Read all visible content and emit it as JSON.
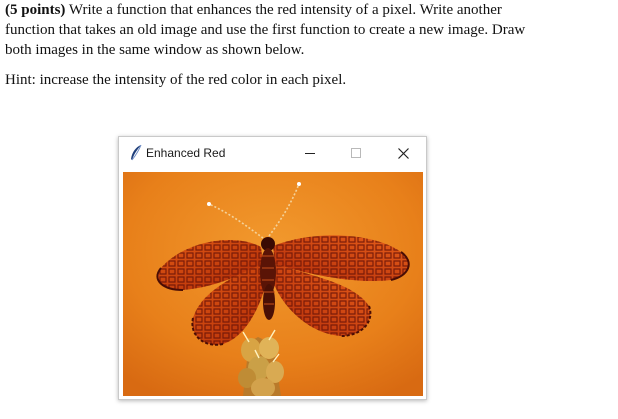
{
  "question": {
    "points_label": "(5 points)",
    "text_line1": "Write a function that enhances the red intensity of a pixel. Write another",
    "text_line2": "function that takes an old image and use the first function to create a new image. Draw",
    "text_line3": "both images in the same window as shown below.",
    "hint": "Hint: increase the intensity of the red color in each pixel."
  },
  "window": {
    "title": "Enhanced Red",
    "icon": "feather-icon",
    "controls": [
      "minimize-icon",
      "maximize-icon",
      "close-icon"
    ]
  },
  "image": {
    "subject": "butterfly-icon",
    "colors": {
      "background": "#e8801a",
      "wing": "#c23b0c",
      "wing_dark": "#7a1608",
      "flower": "#d8a444"
    }
  }
}
